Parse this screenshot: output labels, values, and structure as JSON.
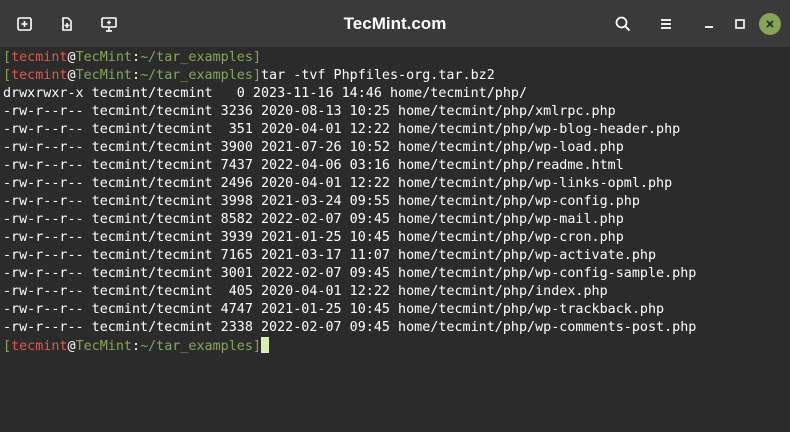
{
  "window": {
    "title": "TecMint.com",
    "accent_color": "#87a556",
    "user_color": "#e0564a",
    "icons": [
      "new-tab-icon",
      "attach-icon",
      "split-view-icon",
      "search-icon",
      "hamburger-menu-icon",
      "minimize-icon",
      "maximize-icon",
      "close-icon"
    ]
  },
  "prompt": {
    "open_bracket": "[",
    "user": "tecmint",
    "at": "@",
    "host": "TecMint",
    "colon": ":",
    "path": "~/tar_examples",
    "close_bracket": "]"
  },
  "command": "tar -tvf Phpfiles-org.tar.bz2",
  "output": [
    "drwxrwxr-x tecmint/tecmint   0 2023-11-16 14:46 home/tecmint/php/",
    "-rw-r--r-- tecmint/tecmint 3236 2020-08-13 10:25 home/tecmint/php/xmlrpc.php",
    "-rw-r--r-- tecmint/tecmint  351 2020-04-01 12:22 home/tecmint/php/wp-blog-header.php",
    "-rw-r--r-- tecmint/tecmint 3900 2021-07-26 10:52 home/tecmint/php/wp-load.php",
    "-rw-r--r-- tecmint/tecmint 7437 2022-04-06 03:16 home/tecmint/php/readme.html",
    "-rw-r--r-- tecmint/tecmint 2496 2020-04-01 12:22 home/tecmint/php/wp-links-opml.php",
    "-rw-r--r-- tecmint/tecmint 3998 2021-03-24 09:55 home/tecmint/php/wp-config.php",
    "-rw-r--r-- tecmint/tecmint 8582 2022-02-07 09:45 home/tecmint/php/wp-mail.php",
    "-rw-r--r-- tecmint/tecmint 3939 2021-01-25 10:45 home/tecmint/php/wp-cron.php",
    "-rw-r--r-- tecmint/tecmint 7165 2021-03-17 11:07 home/tecmint/php/wp-activate.php",
    "-rw-r--r-- tecmint/tecmint 3001 2022-02-07 09:45 home/tecmint/php/wp-config-sample.php",
    "-rw-r--r-- tecmint/tecmint  405 2020-04-01 12:22 home/tecmint/php/index.php",
    "-rw-r--r-- tecmint/tecmint 4747 2021-01-25 10:45 home/tecmint/php/wp-trackback.php",
    "-rw-r--r-- tecmint/tecmint 2338 2022-02-07 09:45 home/tecmint/php/wp-comments-post.php"
  ]
}
